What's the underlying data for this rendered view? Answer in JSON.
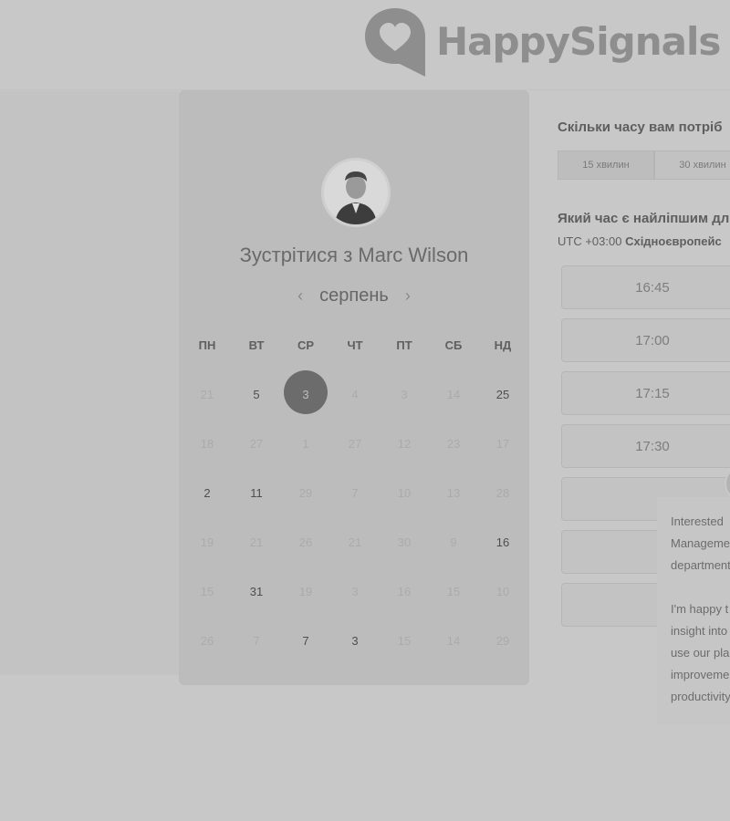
{
  "brand": {
    "name": "HappySignals"
  },
  "meeting": {
    "title": "Зустрітися з Marc Wilson",
    "month": "серпень",
    "weekdays": [
      "ПН",
      "ВТ",
      "СР",
      "ЧТ",
      "ПТ",
      "СБ",
      "НД"
    ],
    "weeks": [
      [
        "21",
        "5",
        "3",
        "4",
        "3",
        "14",
        "25"
      ],
      [
        "18",
        "27",
        "1",
        "27",
        "12",
        "23",
        "17"
      ],
      [
        "2",
        "11",
        "29",
        "7",
        "10",
        "13",
        "28"
      ],
      [
        "19",
        "21",
        "26",
        "21",
        "30",
        "9",
        "16"
      ],
      [
        "15",
        "31",
        "19",
        "3",
        "16",
        "15",
        "10"
      ],
      [
        "26",
        "7",
        "7",
        "3",
        "15",
        "14",
        "29"
      ]
    ]
  },
  "duration": {
    "question": "Скільки часу вам потріб",
    "options": [
      "15 хвилин",
      "30 хвилин"
    ]
  },
  "time": {
    "question": "Який час є найліпшим дл",
    "timezone_prefix": "UTC +03:00",
    "timezone_name": "Східноєвропейс",
    "slots": [
      "16:45",
      "17:00",
      "17:15",
      "17:30",
      "",
      "",
      ""
    ]
  },
  "chat": {
    "lines": [
      "Interested",
      "Manageme",
      "department",
      "",
      "I'm happy t",
      "insight into",
      "use our pla",
      "improveme",
      "productivity"
    ]
  }
}
